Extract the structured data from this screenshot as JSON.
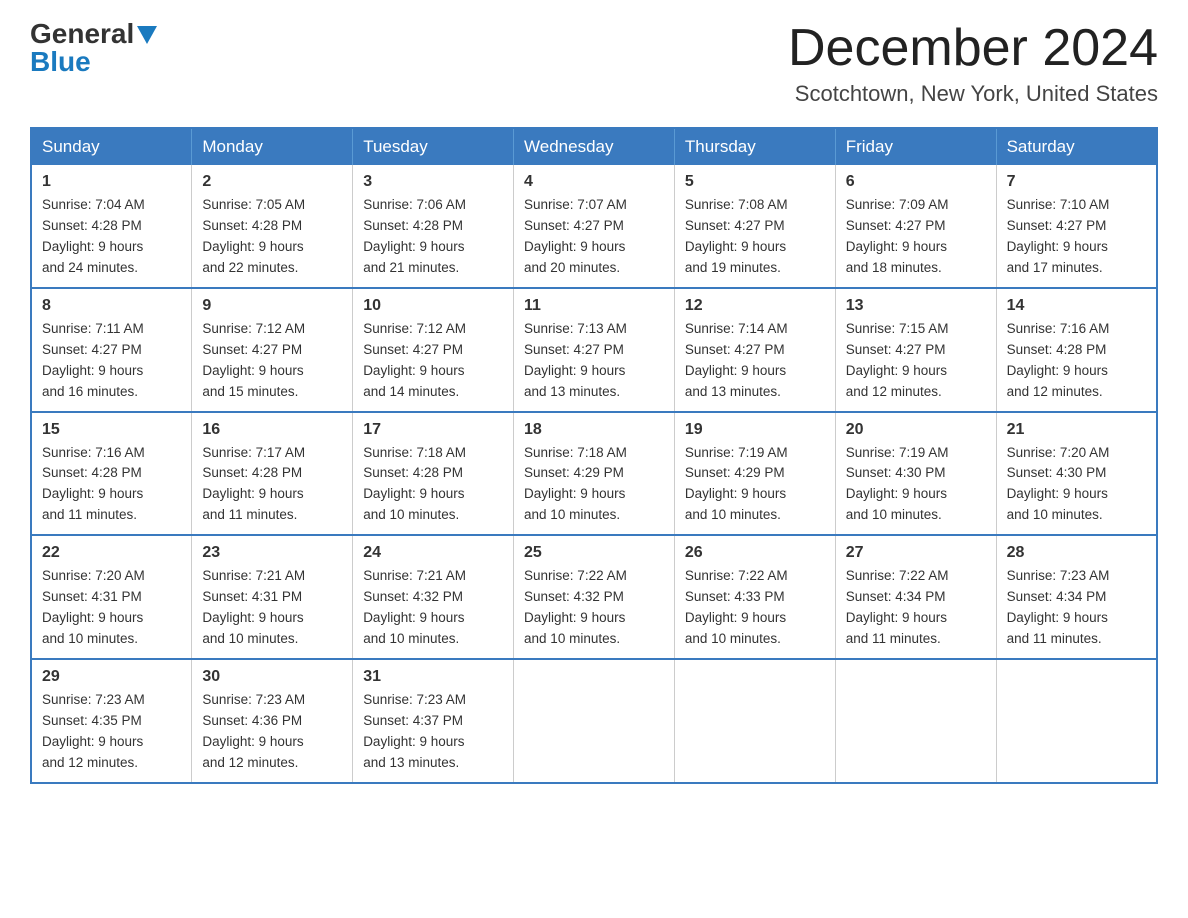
{
  "logo": {
    "general": "General",
    "blue": "Blue"
  },
  "title": "December 2024",
  "location": "Scotchtown, New York, United States",
  "days_of_week": [
    "Sunday",
    "Monday",
    "Tuesday",
    "Wednesday",
    "Thursday",
    "Friday",
    "Saturday"
  ],
  "weeks": [
    [
      {
        "day": 1,
        "sunrise": "7:04 AM",
        "sunset": "4:28 PM",
        "daylight": "9 hours and 24 minutes."
      },
      {
        "day": 2,
        "sunrise": "7:05 AM",
        "sunset": "4:28 PM",
        "daylight": "9 hours and 22 minutes."
      },
      {
        "day": 3,
        "sunrise": "7:06 AM",
        "sunset": "4:28 PM",
        "daylight": "9 hours and 21 minutes."
      },
      {
        "day": 4,
        "sunrise": "7:07 AM",
        "sunset": "4:27 PM",
        "daylight": "9 hours and 20 minutes."
      },
      {
        "day": 5,
        "sunrise": "7:08 AM",
        "sunset": "4:27 PM",
        "daylight": "9 hours and 19 minutes."
      },
      {
        "day": 6,
        "sunrise": "7:09 AM",
        "sunset": "4:27 PM",
        "daylight": "9 hours and 18 minutes."
      },
      {
        "day": 7,
        "sunrise": "7:10 AM",
        "sunset": "4:27 PM",
        "daylight": "9 hours and 17 minutes."
      }
    ],
    [
      {
        "day": 8,
        "sunrise": "7:11 AM",
        "sunset": "4:27 PM",
        "daylight": "9 hours and 16 minutes."
      },
      {
        "day": 9,
        "sunrise": "7:12 AM",
        "sunset": "4:27 PM",
        "daylight": "9 hours and 15 minutes."
      },
      {
        "day": 10,
        "sunrise": "7:12 AM",
        "sunset": "4:27 PM",
        "daylight": "9 hours and 14 minutes."
      },
      {
        "day": 11,
        "sunrise": "7:13 AM",
        "sunset": "4:27 PM",
        "daylight": "9 hours and 13 minutes."
      },
      {
        "day": 12,
        "sunrise": "7:14 AM",
        "sunset": "4:27 PM",
        "daylight": "9 hours and 13 minutes."
      },
      {
        "day": 13,
        "sunrise": "7:15 AM",
        "sunset": "4:27 PM",
        "daylight": "9 hours and 12 minutes."
      },
      {
        "day": 14,
        "sunrise": "7:16 AM",
        "sunset": "4:28 PM",
        "daylight": "9 hours and 12 minutes."
      }
    ],
    [
      {
        "day": 15,
        "sunrise": "7:16 AM",
        "sunset": "4:28 PM",
        "daylight": "9 hours and 11 minutes."
      },
      {
        "day": 16,
        "sunrise": "7:17 AM",
        "sunset": "4:28 PM",
        "daylight": "9 hours and 11 minutes."
      },
      {
        "day": 17,
        "sunrise": "7:18 AM",
        "sunset": "4:28 PM",
        "daylight": "9 hours and 10 minutes."
      },
      {
        "day": 18,
        "sunrise": "7:18 AM",
        "sunset": "4:29 PM",
        "daylight": "9 hours and 10 minutes."
      },
      {
        "day": 19,
        "sunrise": "7:19 AM",
        "sunset": "4:29 PM",
        "daylight": "9 hours and 10 minutes."
      },
      {
        "day": 20,
        "sunrise": "7:19 AM",
        "sunset": "4:30 PM",
        "daylight": "9 hours and 10 minutes."
      },
      {
        "day": 21,
        "sunrise": "7:20 AM",
        "sunset": "4:30 PM",
        "daylight": "9 hours and 10 minutes."
      }
    ],
    [
      {
        "day": 22,
        "sunrise": "7:20 AM",
        "sunset": "4:31 PM",
        "daylight": "9 hours and 10 minutes."
      },
      {
        "day": 23,
        "sunrise": "7:21 AM",
        "sunset": "4:31 PM",
        "daylight": "9 hours and 10 minutes."
      },
      {
        "day": 24,
        "sunrise": "7:21 AM",
        "sunset": "4:32 PM",
        "daylight": "9 hours and 10 minutes."
      },
      {
        "day": 25,
        "sunrise": "7:22 AM",
        "sunset": "4:32 PM",
        "daylight": "9 hours and 10 minutes."
      },
      {
        "day": 26,
        "sunrise": "7:22 AM",
        "sunset": "4:33 PM",
        "daylight": "9 hours and 10 minutes."
      },
      {
        "day": 27,
        "sunrise": "7:22 AM",
        "sunset": "4:34 PM",
        "daylight": "9 hours and 11 minutes."
      },
      {
        "day": 28,
        "sunrise": "7:23 AM",
        "sunset": "4:34 PM",
        "daylight": "9 hours and 11 minutes."
      }
    ],
    [
      {
        "day": 29,
        "sunrise": "7:23 AM",
        "sunset": "4:35 PM",
        "daylight": "9 hours and 12 minutes."
      },
      {
        "day": 30,
        "sunrise": "7:23 AM",
        "sunset": "4:36 PM",
        "daylight": "9 hours and 12 minutes."
      },
      {
        "day": 31,
        "sunrise": "7:23 AM",
        "sunset": "4:37 PM",
        "daylight": "9 hours and 13 minutes."
      },
      null,
      null,
      null,
      null
    ]
  ],
  "labels": {
    "sunrise": "Sunrise:",
    "sunset": "Sunset:",
    "daylight": "Daylight:"
  }
}
